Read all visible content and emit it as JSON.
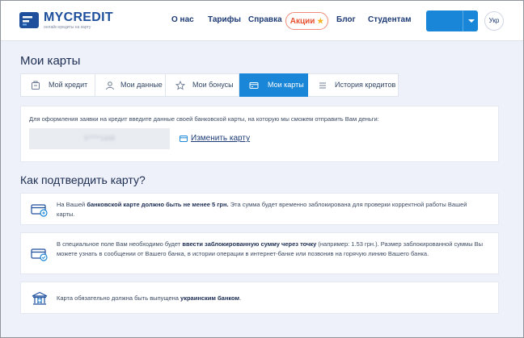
{
  "header": {
    "logo_name": "MYCREDIT",
    "logo_tagline": "онлайн кредиты на карту",
    "nav": [
      "О нас",
      "Тарифы",
      "Справка"
    ],
    "promo_label": "Акции",
    "nav_right": [
      "Блог",
      "Студентам"
    ],
    "cabinet_label": "",
    "language": "Укр"
  },
  "page": {
    "title": "Мои карты"
  },
  "tabs": [
    {
      "label": "Мой кредит",
      "icon": "credit-card-icon"
    },
    {
      "label": "Мои данные",
      "icon": "user-icon"
    },
    {
      "label": "Мои бонусы",
      "icon": "star-icon"
    },
    {
      "label": "Мои карты",
      "icon": "cards-icon",
      "active": true
    },
    {
      "label": "История кредитов",
      "icon": "list-icon"
    }
  ],
  "card_panel": {
    "instruction": "Для оформления заявки на кредит введите данные своей банковской карты, на которую мы сможем отправить Вам деньги:",
    "masked_number": "5*****1448",
    "change_link": "Изменить карту"
  },
  "confirm": {
    "title": "Как подтвердить карту?",
    "item1": {
      "before": "На Вашей ",
      "bold": "банковской карте должно быть не менее 5 грн.",
      "after": " Эта сумма будет временно заблокирована для проверки корректной работы Вашей карты."
    },
    "item2": {
      "before": "В специальное поле Вам необходимо будет ",
      "bold": "ввести заблокированную сумму через точку",
      "after": " (например: 1.53 грн.). Размер заблокированной суммы Вы можете узнать в сообщении от Вашего банка, в истории операции в интернет-банке или позвонив на горячую линию Вашего банка."
    },
    "item3": {
      "before": "Карта обязательно должна быть выпущена ",
      "bold": "украинским банком",
      "after": "."
    }
  },
  "colors": {
    "brand_blue": "#1d4f9c",
    "accent_blue": "#1a86d8",
    "promo_red": "#e8502f",
    "background": "#eef1f9"
  }
}
